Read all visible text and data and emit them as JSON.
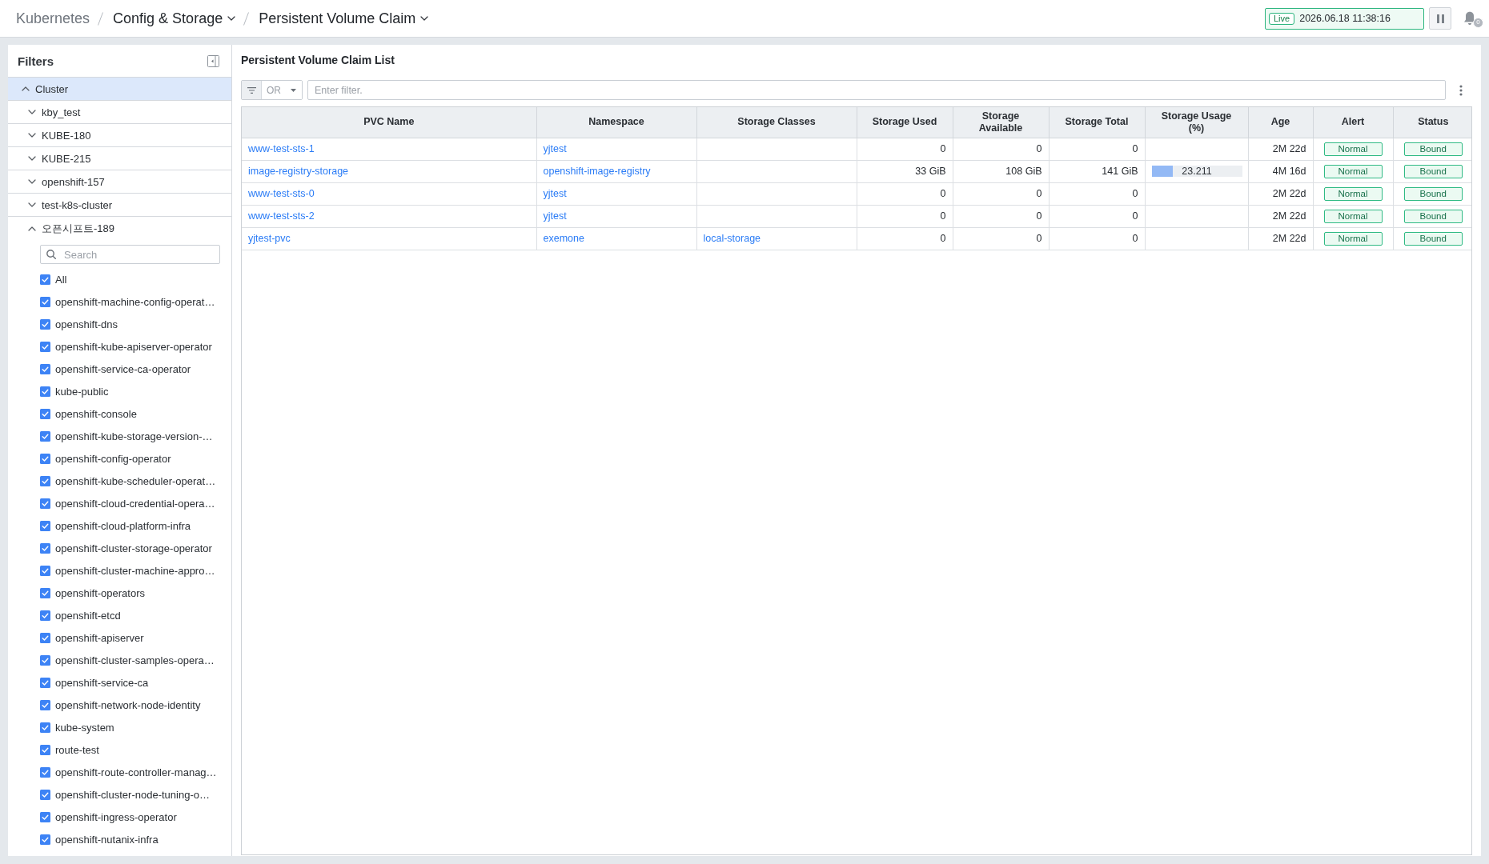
{
  "breadcrumb": [
    {
      "label": "Kubernetes",
      "kind": "link"
    },
    {
      "label": "Config & Storage",
      "kind": "dropdown"
    },
    {
      "label": "Persistent Volume Claim",
      "kind": "dropdown"
    }
  ],
  "live_status": {
    "tag": "Live",
    "timestamp": "2026.06.18 11:38:16"
  },
  "notifications": {
    "count": "0"
  },
  "filters": {
    "title": "Filters",
    "tree": [
      {
        "label": "Cluster",
        "selected": true,
        "expanded": true,
        "children": [
          {
            "label": "kby_test",
            "selected": false,
            "expanded": false
          },
          {
            "label": "KUBE-180",
            "selected": false,
            "expanded": false
          },
          {
            "label": "KUBE-215",
            "selected": false,
            "expanded": false
          },
          {
            "label": "openshift-157",
            "selected": false,
            "expanded": false
          },
          {
            "label": "test-k8s-cluster",
            "selected": false,
            "expanded": false
          },
          {
            "label": "오픈시프트-189",
            "selected": false,
            "expanded": true,
            "search": {
              "placeholder": "Search"
            },
            "options": [
              {
                "label": "All",
                "checked": true
              },
              {
                "label": "openshift-machine-config-operat…",
                "checked": true
              },
              {
                "label": "openshift-dns",
                "checked": true
              },
              {
                "label": "openshift-kube-apiserver-operator",
                "checked": true
              },
              {
                "label": "openshift-service-ca-operator",
                "checked": true
              },
              {
                "label": "kube-public",
                "checked": true
              },
              {
                "label": "openshift-console",
                "checked": true
              },
              {
                "label": "openshift-kube-storage-version-…",
                "checked": true
              },
              {
                "label": "openshift-config-operator",
                "checked": true
              },
              {
                "label": "openshift-kube-scheduler-operat…",
                "checked": true
              },
              {
                "label": "openshift-cloud-credential-opera…",
                "checked": true
              },
              {
                "label": "openshift-cloud-platform-infra",
                "checked": true
              },
              {
                "label": "openshift-cluster-storage-operator",
                "checked": true
              },
              {
                "label": "openshift-cluster-machine-appro…",
                "checked": true
              },
              {
                "label": "openshift-operators",
                "checked": true
              },
              {
                "label": "openshift-etcd",
                "checked": true
              },
              {
                "label": "openshift-apiserver",
                "checked": true
              },
              {
                "label": "openshift-cluster-samples-opera…",
                "checked": true
              },
              {
                "label": "openshift-service-ca",
                "checked": true
              },
              {
                "label": "openshift-network-node-identity",
                "checked": true
              },
              {
                "label": "kube-system",
                "checked": true
              },
              {
                "label": "route-test",
                "checked": true
              },
              {
                "label": "openshift-route-controller-manag…",
                "checked": true
              },
              {
                "label": "openshift-cluster-node-tuning-o…",
                "checked": true
              },
              {
                "label": "openshift-ingress-operator",
                "checked": true
              },
              {
                "label": "openshift-nutanix-infra",
                "checked": true
              }
            ]
          }
        ]
      }
    ]
  },
  "content": {
    "title": "Persistent Volume Claim List",
    "filter": {
      "operator": "OR",
      "placeholder": "Enter filter."
    },
    "table": {
      "columns": [
        "PVC Name",
        "Namespace",
        "Storage Classes",
        "Storage Used",
        "Storage Available",
        "Storage Total",
        "Storage Usage (%)",
        "Age",
        "Alert",
        "Status"
      ],
      "rows": [
        {
          "pvc_name": "www-test-sts-1",
          "namespace": "yjtest",
          "storage_used": "0",
          "storage_available": "0",
          "storage_total": "0",
          "age": "2M 22d",
          "alert": "Normal",
          "status": "Bound"
        },
        {
          "pvc_name": "image-registry-storage",
          "namespace": "openshift-image-registry",
          "storage_used": "33 GiB",
          "storage_available": "108 GiB",
          "storage_total": "141 GiB",
          "storage_usage": {
            "level": 0.232,
            "reading": "23.211"
          },
          "age": "4M 16d",
          "alert": "Normal",
          "status": "Bound"
        },
        {
          "pvc_name": "www-test-sts-0",
          "namespace": "yjtest",
          "storage_used": "0",
          "storage_available": "0",
          "storage_total": "0",
          "age": "2M 22d",
          "alert": "Normal",
          "status": "Bound"
        },
        {
          "pvc_name": "www-test-sts-2",
          "namespace": "yjtest",
          "storage_used": "0",
          "storage_available": "0",
          "storage_total": "0",
          "age": "2M 22d",
          "alert": "Normal",
          "status": "Bound"
        },
        {
          "pvc_name": "yjtest-pvc",
          "namespace": "exemone",
          "storage_class": "local-storage",
          "storage_used": "0",
          "storage_available": "0",
          "storage_total": "0",
          "age": "2M 22d",
          "alert": "Normal",
          "status": "Bound"
        }
      ]
    }
  }
}
